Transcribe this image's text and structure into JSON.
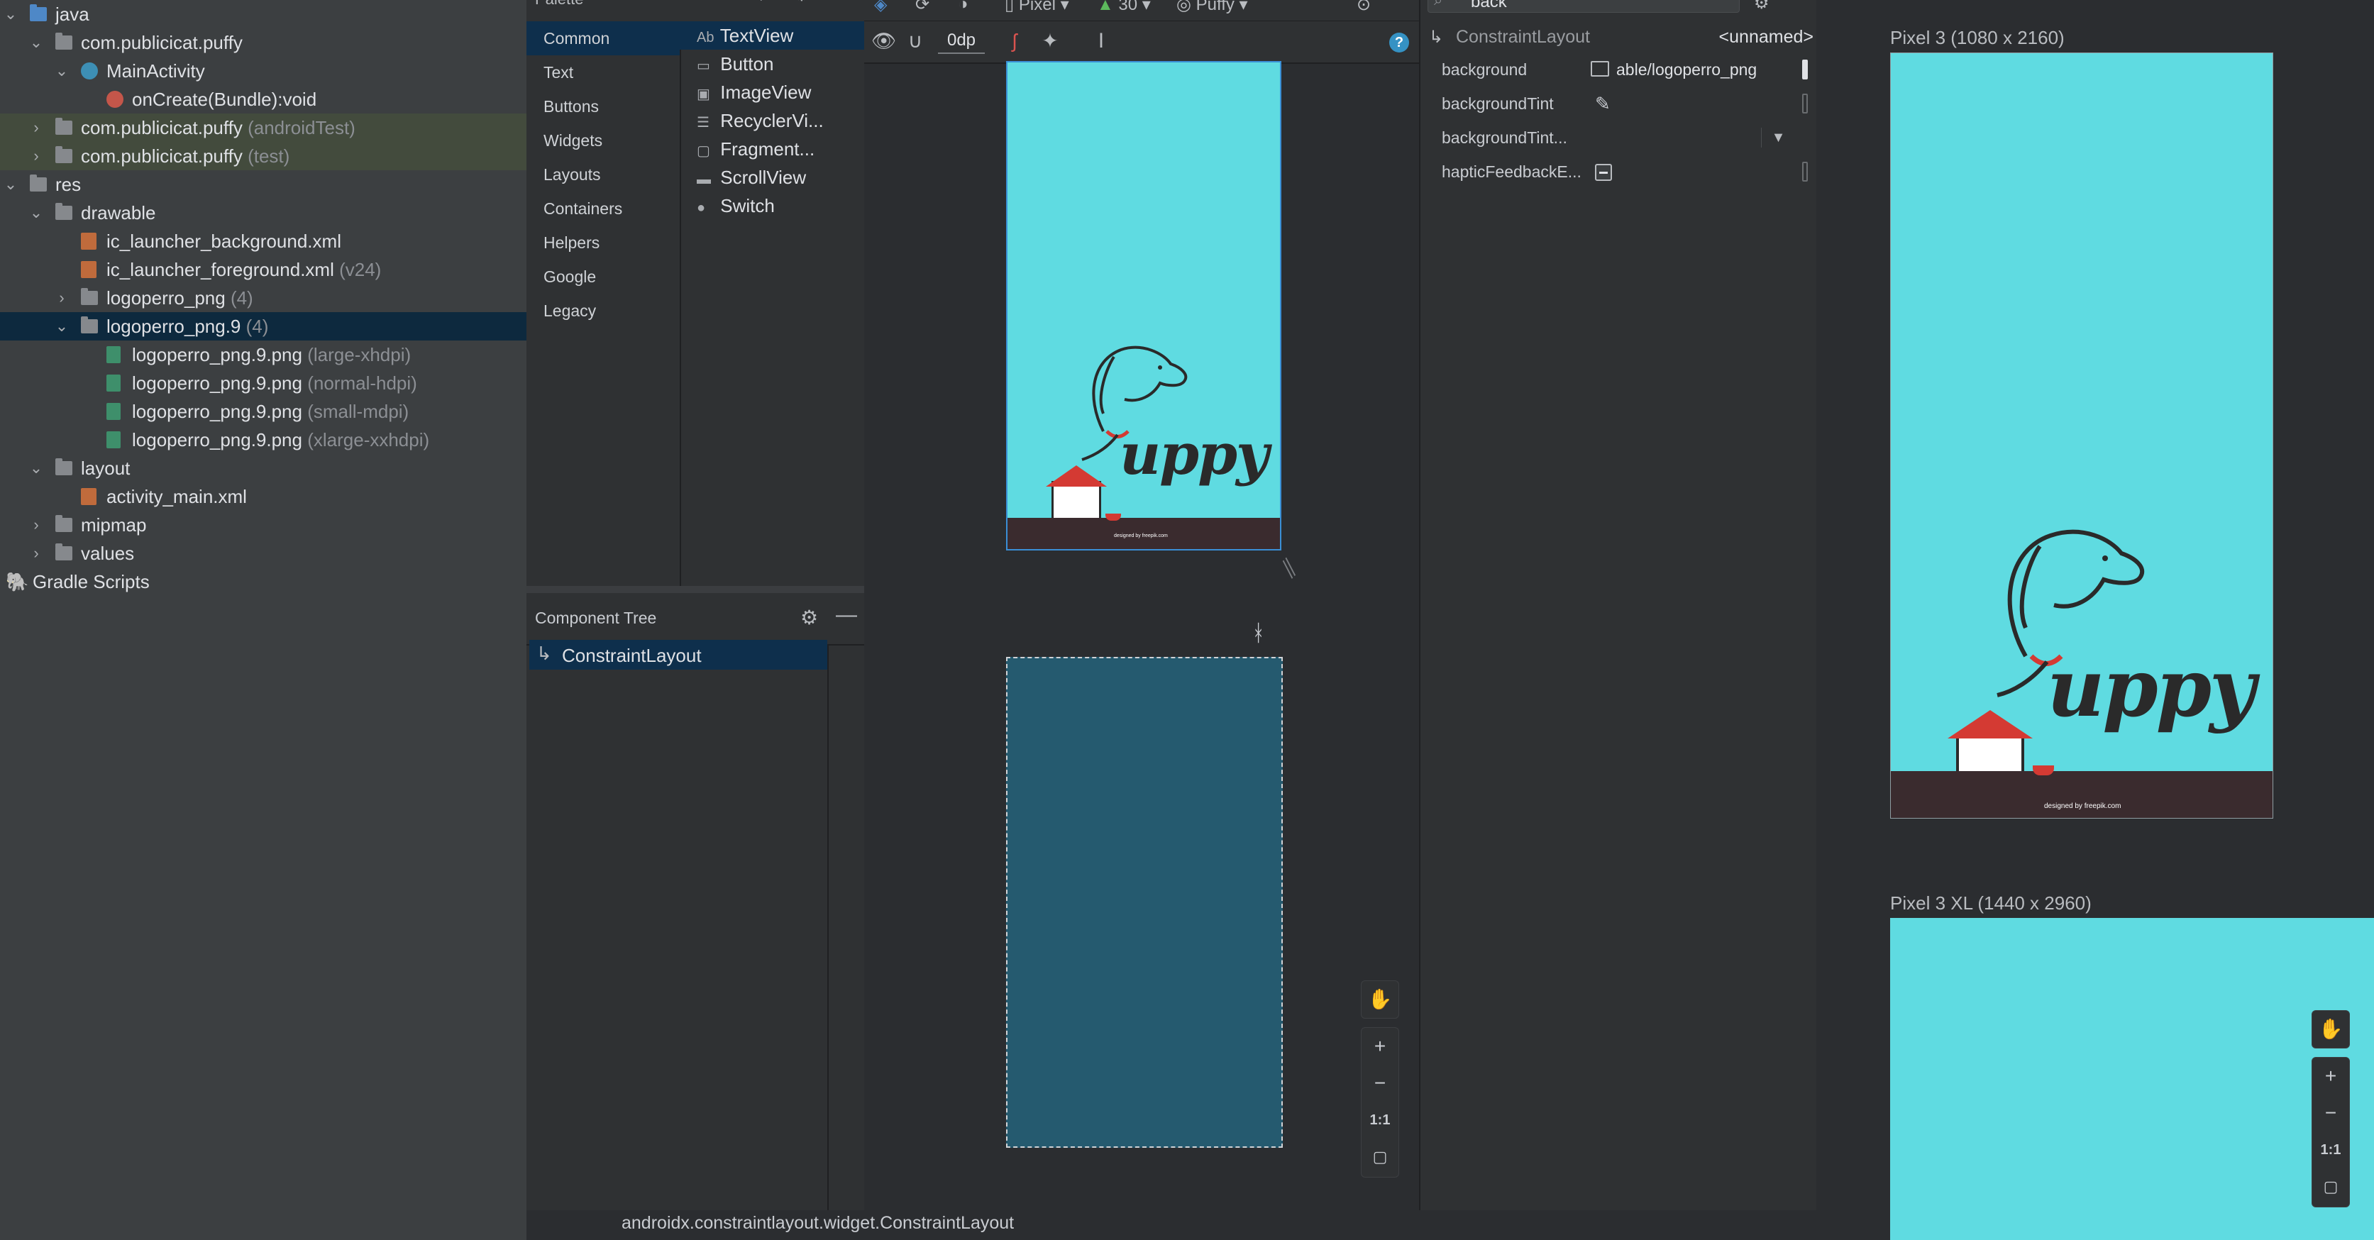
{
  "colors": {
    "screen_bg": "#5fdbe1",
    "blueprint_bg": "#255a6f",
    "footer_bar": "#3a2b2e",
    "dog_line": "#2a2a2a",
    "collar_red": "#d43a33",
    "selection_blue": "#0e2f4c",
    "green_highlight": "#434b3d"
  },
  "project_tree": {
    "items": [
      {
        "label": "java",
        "hint": ""
      },
      {
        "label": "com.publicicat.puffy",
        "hint": ""
      },
      {
        "label": "MainActivity",
        "hint": ""
      },
      {
        "label": "onCreate(Bundle):void",
        "hint": ""
      },
      {
        "label": "com.publicicat.puffy",
        "hint": "(androidTest)"
      },
      {
        "label": "com.publicicat.puffy",
        "hint": "(test)"
      },
      {
        "label": "res",
        "hint": ""
      },
      {
        "label": "drawable",
        "hint": ""
      },
      {
        "label": "ic_launcher_background.xml",
        "hint": ""
      },
      {
        "label": "ic_launcher_foreground.xml",
        "hint": "(v24)"
      },
      {
        "label": "logoperro_png",
        "hint": "(4)"
      },
      {
        "label": "logoperro_png.9",
        "hint": "(4)"
      },
      {
        "label": "logoperro_png.9.png",
        "hint": "(large-xhdpi)"
      },
      {
        "label": "logoperro_png.9.png",
        "hint": "(normal-hdpi)"
      },
      {
        "label": "logoperro_png.9.png",
        "hint": "(small-mdpi)"
      },
      {
        "label": "logoperro_png.9.png",
        "hint": "(xlarge-xxhdpi)"
      },
      {
        "label": "layout",
        "hint": ""
      },
      {
        "label": "activity_main.xml",
        "hint": ""
      },
      {
        "label": "mipmap",
        "hint": ""
      },
      {
        "label": "values",
        "hint": ""
      },
      {
        "label": "Gradle Scripts",
        "hint": ""
      }
    ]
  },
  "palette": {
    "title": "Palette",
    "categories": [
      "Common",
      "Text",
      "Buttons",
      "Widgets",
      "Layouts",
      "Containers",
      "Helpers",
      "Google",
      "Legacy"
    ],
    "items": [
      {
        "icon": "Ab",
        "label": "TextView"
      },
      {
        "icon": "▭",
        "label": "Button"
      },
      {
        "icon": "▣",
        "label": "ImageView"
      },
      {
        "icon": "☰",
        "label": "RecyclerVi..."
      },
      {
        "icon": "▢",
        "label": "Fragment..."
      },
      {
        "icon": "▬",
        "label": "ScrollView"
      },
      {
        "icon": "●",
        "label": "Switch"
      }
    ]
  },
  "toolbar": {
    "device": "Pixel",
    "api": "30",
    "theme": "Puffy",
    "margin": "0dp"
  },
  "component_tree": {
    "title": "Component Tree",
    "root": "ConstraintLayout"
  },
  "attributes": {
    "search": "back",
    "component_type": "ConstraintLayout",
    "component_id": "<unnamed>",
    "rows": [
      {
        "name": "background",
        "value": "able/logoperro_png"
      },
      {
        "name": "backgroundTint",
        "value": ""
      },
      {
        "name": "backgroundTint...",
        "value": ""
      },
      {
        "name": "hapticFeedbackE...",
        "value": ""
      }
    ]
  },
  "preview": {
    "device1": "Pixel 3 (1080 x 2160)",
    "device2": "Pixel 3 XL (1440 x 2960)",
    "logo_text": "uppy",
    "credit": "designed by freepik.com"
  },
  "zoom": {
    "plus": "+",
    "minus": "−",
    "one_to_one": "1:1"
  },
  "status_bar": {
    "text": "androidx.constraintlayout.widget.ConstraintLayout"
  }
}
